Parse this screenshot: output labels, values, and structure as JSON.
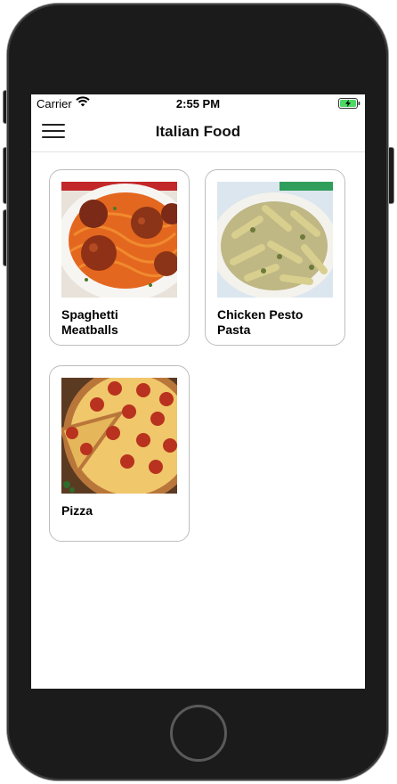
{
  "status_bar": {
    "carrier": "Carrier",
    "time": "2:55 PM",
    "wifi_icon": "wifi-icon",
    "battery_icon": "battery-charging-icon"
  },
  "nav": {
    "title": "Italian Food",
    "menu_icon": "hamburger-menu-icon"
  },
  "recipes": [
    {
      "name": "Spaghetti\nMeatballs",
      "image": "spaghetti-meatballs-photo"
    },
    {
      "name": "Chicken Pesto\nPasta",
      "image": "chicken-pesto-pasta-photo"
    },
    {
      "name": "Pizza",
      "image": "pepperoni-pizza-photo"
    }
  ],
  "colors": {
    "phone_frame": "#1b1b1b",
    "card_border": "#bdbdbd",
    "battery_charging": "#4cd964"
  }
}
